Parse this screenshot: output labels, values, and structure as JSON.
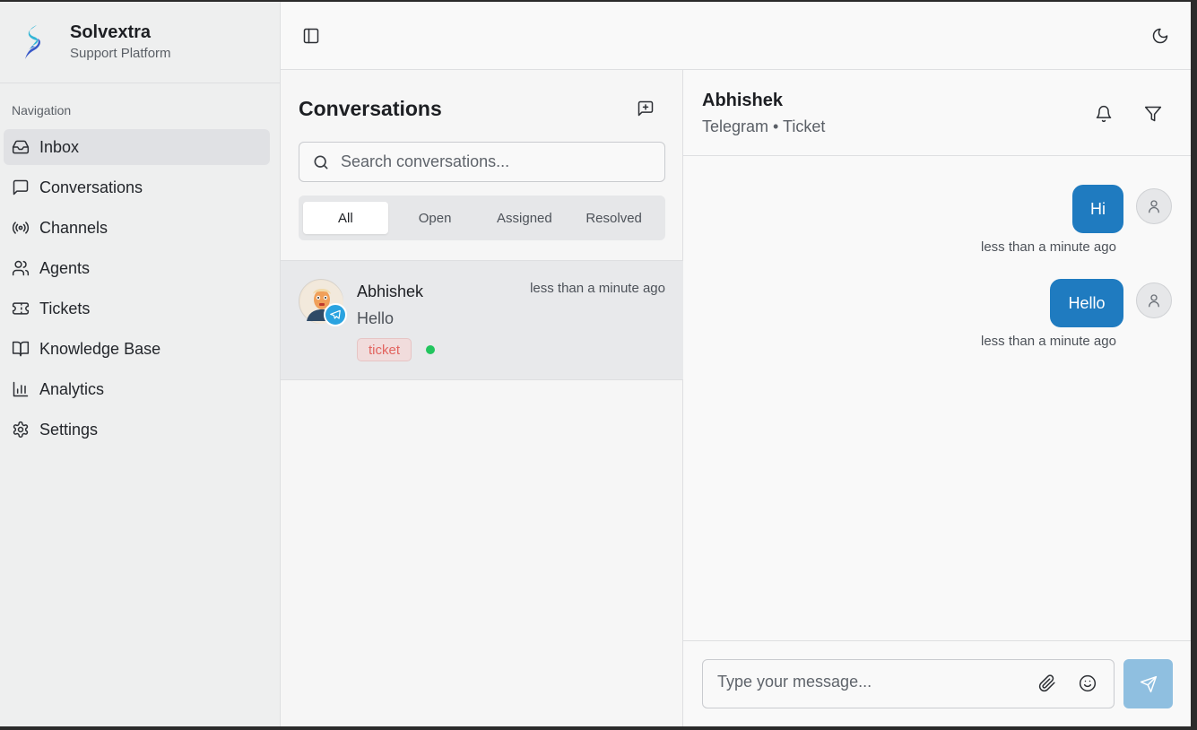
{
  "brand": {
    "name": "Solvextra",
    "subtitle": "Support Platform"
  },
  "sidebar": {
    "section_label": "Navigation",
    "items": [
      {
        "label": "Inbox",
        "icon": "inbox-icon",
        "active": true
      },
      {
        "label": "Conversations",
        "icon": "message-square-icon"
      },
      {
        "label": "Channels",
        "icon": "radio-icon"
      },
      {
        "label": "Agents",
        "icon": "users-icon"
      },
      {
        "label": "Tickets",
        "icon": "ticket-icon"
      },
      {
        "label": "Knowledge Base",
        "icon": "book-open-icon"
      },
      {
        "label": "Analytics",
        "icon": "bar-chart-icon"
      },
      {
        "label": "Settings",
        "icon": "gear-icon"
      }
    ]
  },
  "topbar": {
    "left_icon": "sidebar-toggle-icon",
    "right_icon": "moon-icon"
  },
  "conversations": {
    "title": "Conversations",
    "new_icon": "new-message-icon",
    "search_placeholder": "Search conversations...",
    "tabs": [
      {
        "label": "All",
        "active": true
      },
      {
        "label": "Open"
      },
      {
        "label": "Assigned"
      },
      {
        "label": "Resolved"
      }
    ],
    "items": [
      {
        "name": "Abhishek",
        "time": "less than a minute ago",
        "preview": "Hello",
        "tag": "ticket",
        "channel_icon": "telegram-icon",
        "status": "online"
      }
    ]
  },
  "chat": {
    "name": "Abhishek",
    "meta": "Telegram • Ticket",
    "messages": [
      {
        "text": "Hi",
        "time": "less than a minute ago"
      },
      {
        "text": "Hello",
        "time": "less than a minute ago"
      }
    ],
    "input_placeholder": "Type your message..."
  },
  "colors": {
    "accent": "#1f7bc0",
    "send_button": "#8fbfe0",
    "tag_text": "#e2645f",
    "tag_bg": "#f1dcdc",
    "online": "#22c55e",
    "telegram": "#2aa3e0"
  }
}
